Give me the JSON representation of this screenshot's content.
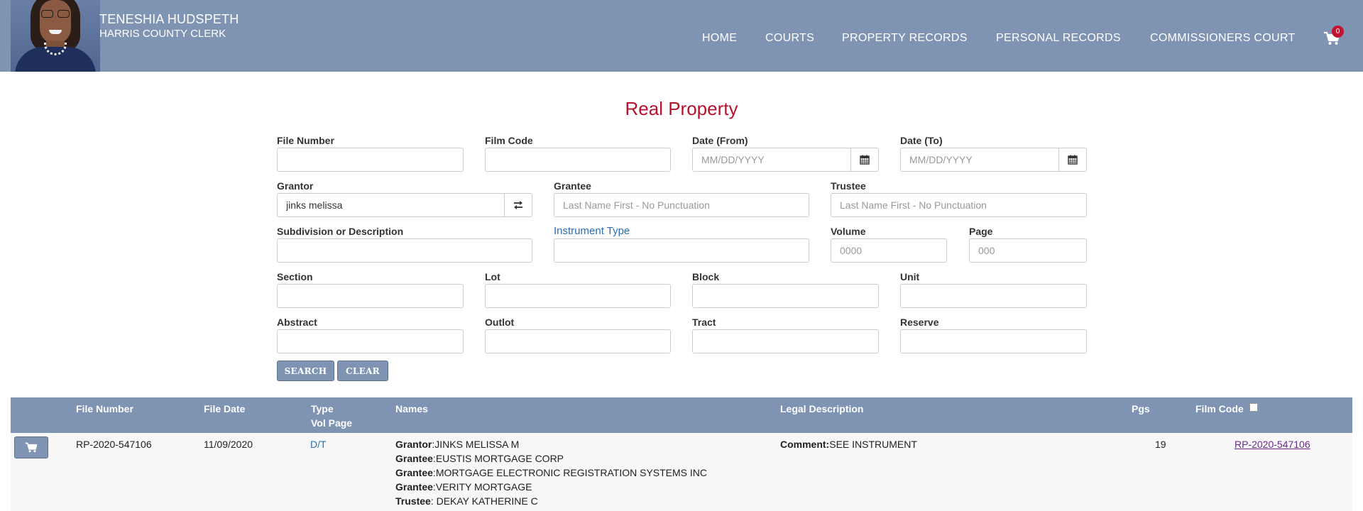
{
  "header": {
    "clerk_name": "TENESHIA HUDSPETH",
    "clerk_title": "HARRIS COUNTY CLERK",
    "nav": [
      "HOME",
      "COURTS",
      "PROPERTY RECORDS",
      "PERSONAL RECORDS",
      "COMMISSIONERS COURT"
    ],
    "cart_count": "0"
  },
  "form": {
    "title": "Real Property",
    "file_number": {
      "label": "File Number",
      "value": ""
    },
    "film_code": {
      "label": "Film Code",
      "value": ""
    },
    "date_from": {
      "label": "Date (From)",
      "placeholder": "MM/DD/YYYY"
    },
    "date_to": {
      "label": "Date (To)",
      "placeholder": "MM/DD/YYYY"
    },
    "grantor": {
      "label": "Grantor",
      "value": "jinks melissa"
    },
    "grantee": {
      "label": "Grantee",
      "placeholder": "Last Name First - No Punctuation"
    },
    "trustee": {
      "label": "Trustee",
      "placeholder": "Last Name First - No Punctuation"
    },
    "subdivision": {
      "label": "Subdivision or Description",
      "value": ""
    },
    "instrument_type": {
      "label": "Instrument Type",
      "value": ""
    },
    "volume": {
      "label": "Volume",
      "placeholder": "0000"
    },
    "page": {
      "label": "Page",
      "placeholder": "000"
    },
    "section": {
      "label": "Section",
      "value": ""
    },
    "lot": {
      "label": "Lot",
      "value": ""
    },
    "block": {
      "label": "Block",
      "value": ""
    },
    "unit": {
      "label": "Unit",
      "value": ""
    },
    "abstract": {
      "label": "Abstract",
      "value": ""
    },
    "outlot": {
      "label": "Outlot",
      "value": ""
    },
    "tract": {
      "label": "Tract",
      "value": ""
    },
    "reserve": {
      "label": "Reserve",
      "value": ""
    },
    "search_label": "SEARCH",
    "clear_label": "CLEAR"
  },
  "results": {
    "headers": {
      "file_number": "File Number",
      "file_date": "File Date",
      "type": "Type",
      "vol_page": "Vol Page",
      "names": "Names",
      "legal_description": "Legal Description",
      "pgs": "Pgs",
      "film_code": "Film Code"
    },
    "rows": [
      {
        "file_number": "RP-2020-547106",
        "file_date": "11/09/2020",
        "type": "D/T",
        "names": [
          {
            "role": "Grantor",
            "sep": ":",
            "name": "JINKS MELISSA M"
          },
          {
            "role": "Grantee",
            "sep": ":",
            "name": "EUSTIS MORTGAGE CORP"
          },
          {
            "role": "Grantee",
            "sep": ":",
            "name": "MORTGAGE ELECTRONIC REGISTRATION SYSTEMS INC"
          },
          {
            "role": "Grantee",
            "sep": ":",
            "name": "VERITY MORTGAGE"
          },
          {
            "role": "Trustee",
            "sep": ": ",
            "name": "DEKAY KATHERINE C"
          }
        ],
        "comment_label": "Comment:",
        "comment": "SEE INSTRUMENT",
        "pgs": "19",
        "film_code": "RP-2020-547106"
      }
    ]
  }
}
